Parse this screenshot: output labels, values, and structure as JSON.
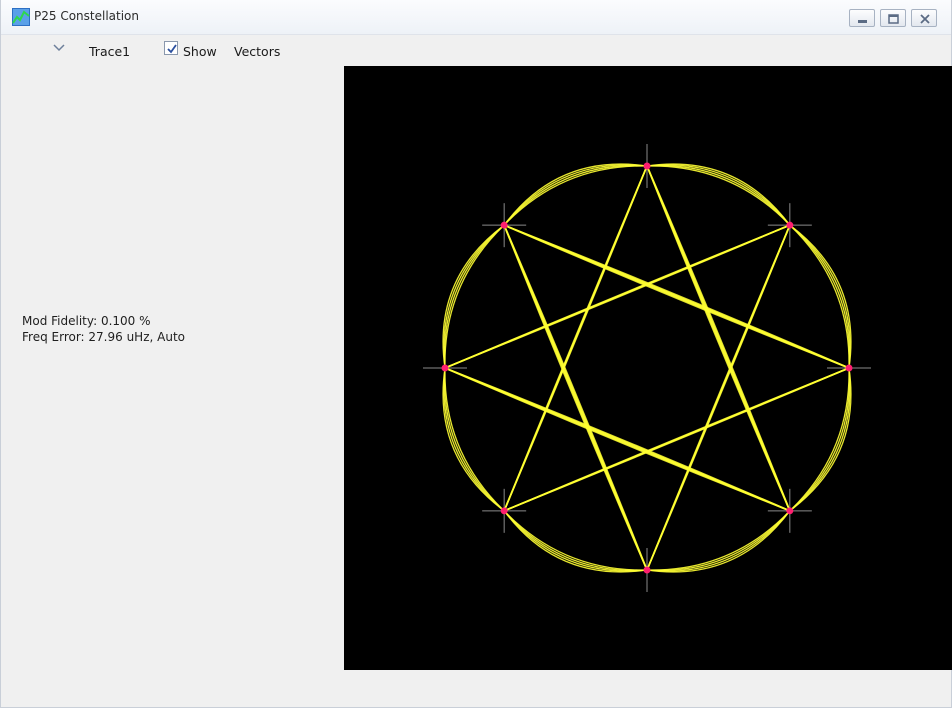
{
  "window": {
    "title": "P25 Constellation",
    "icon": "app-chart-icon",
    "buttons": {
      "minimize": "minimize-icon",
      "restore": "restore-icon",
      "close": "close-icon"
    }
  },
  "toolbar": {
    "trace_dropdown_icon": "chevron-down-icon",
    "trace_label": "Trace1",
    "show_checked": true,
    "show_label": "Show",
    "vectors_label": "Vectors"
  },
  "readouts": {
    "mod_fidelity": "Mod Fidelity:  0.100 %",
    "freq_error": "Freq Error: 27.96 uHz, Auto"
  },
  "constellation": {
    "background": "#000000",
    "trace_color": "#ffff33",
    "symbol_color": "#ff1f6f",
    "axis_color": "#8a8a8a"
  }
}
